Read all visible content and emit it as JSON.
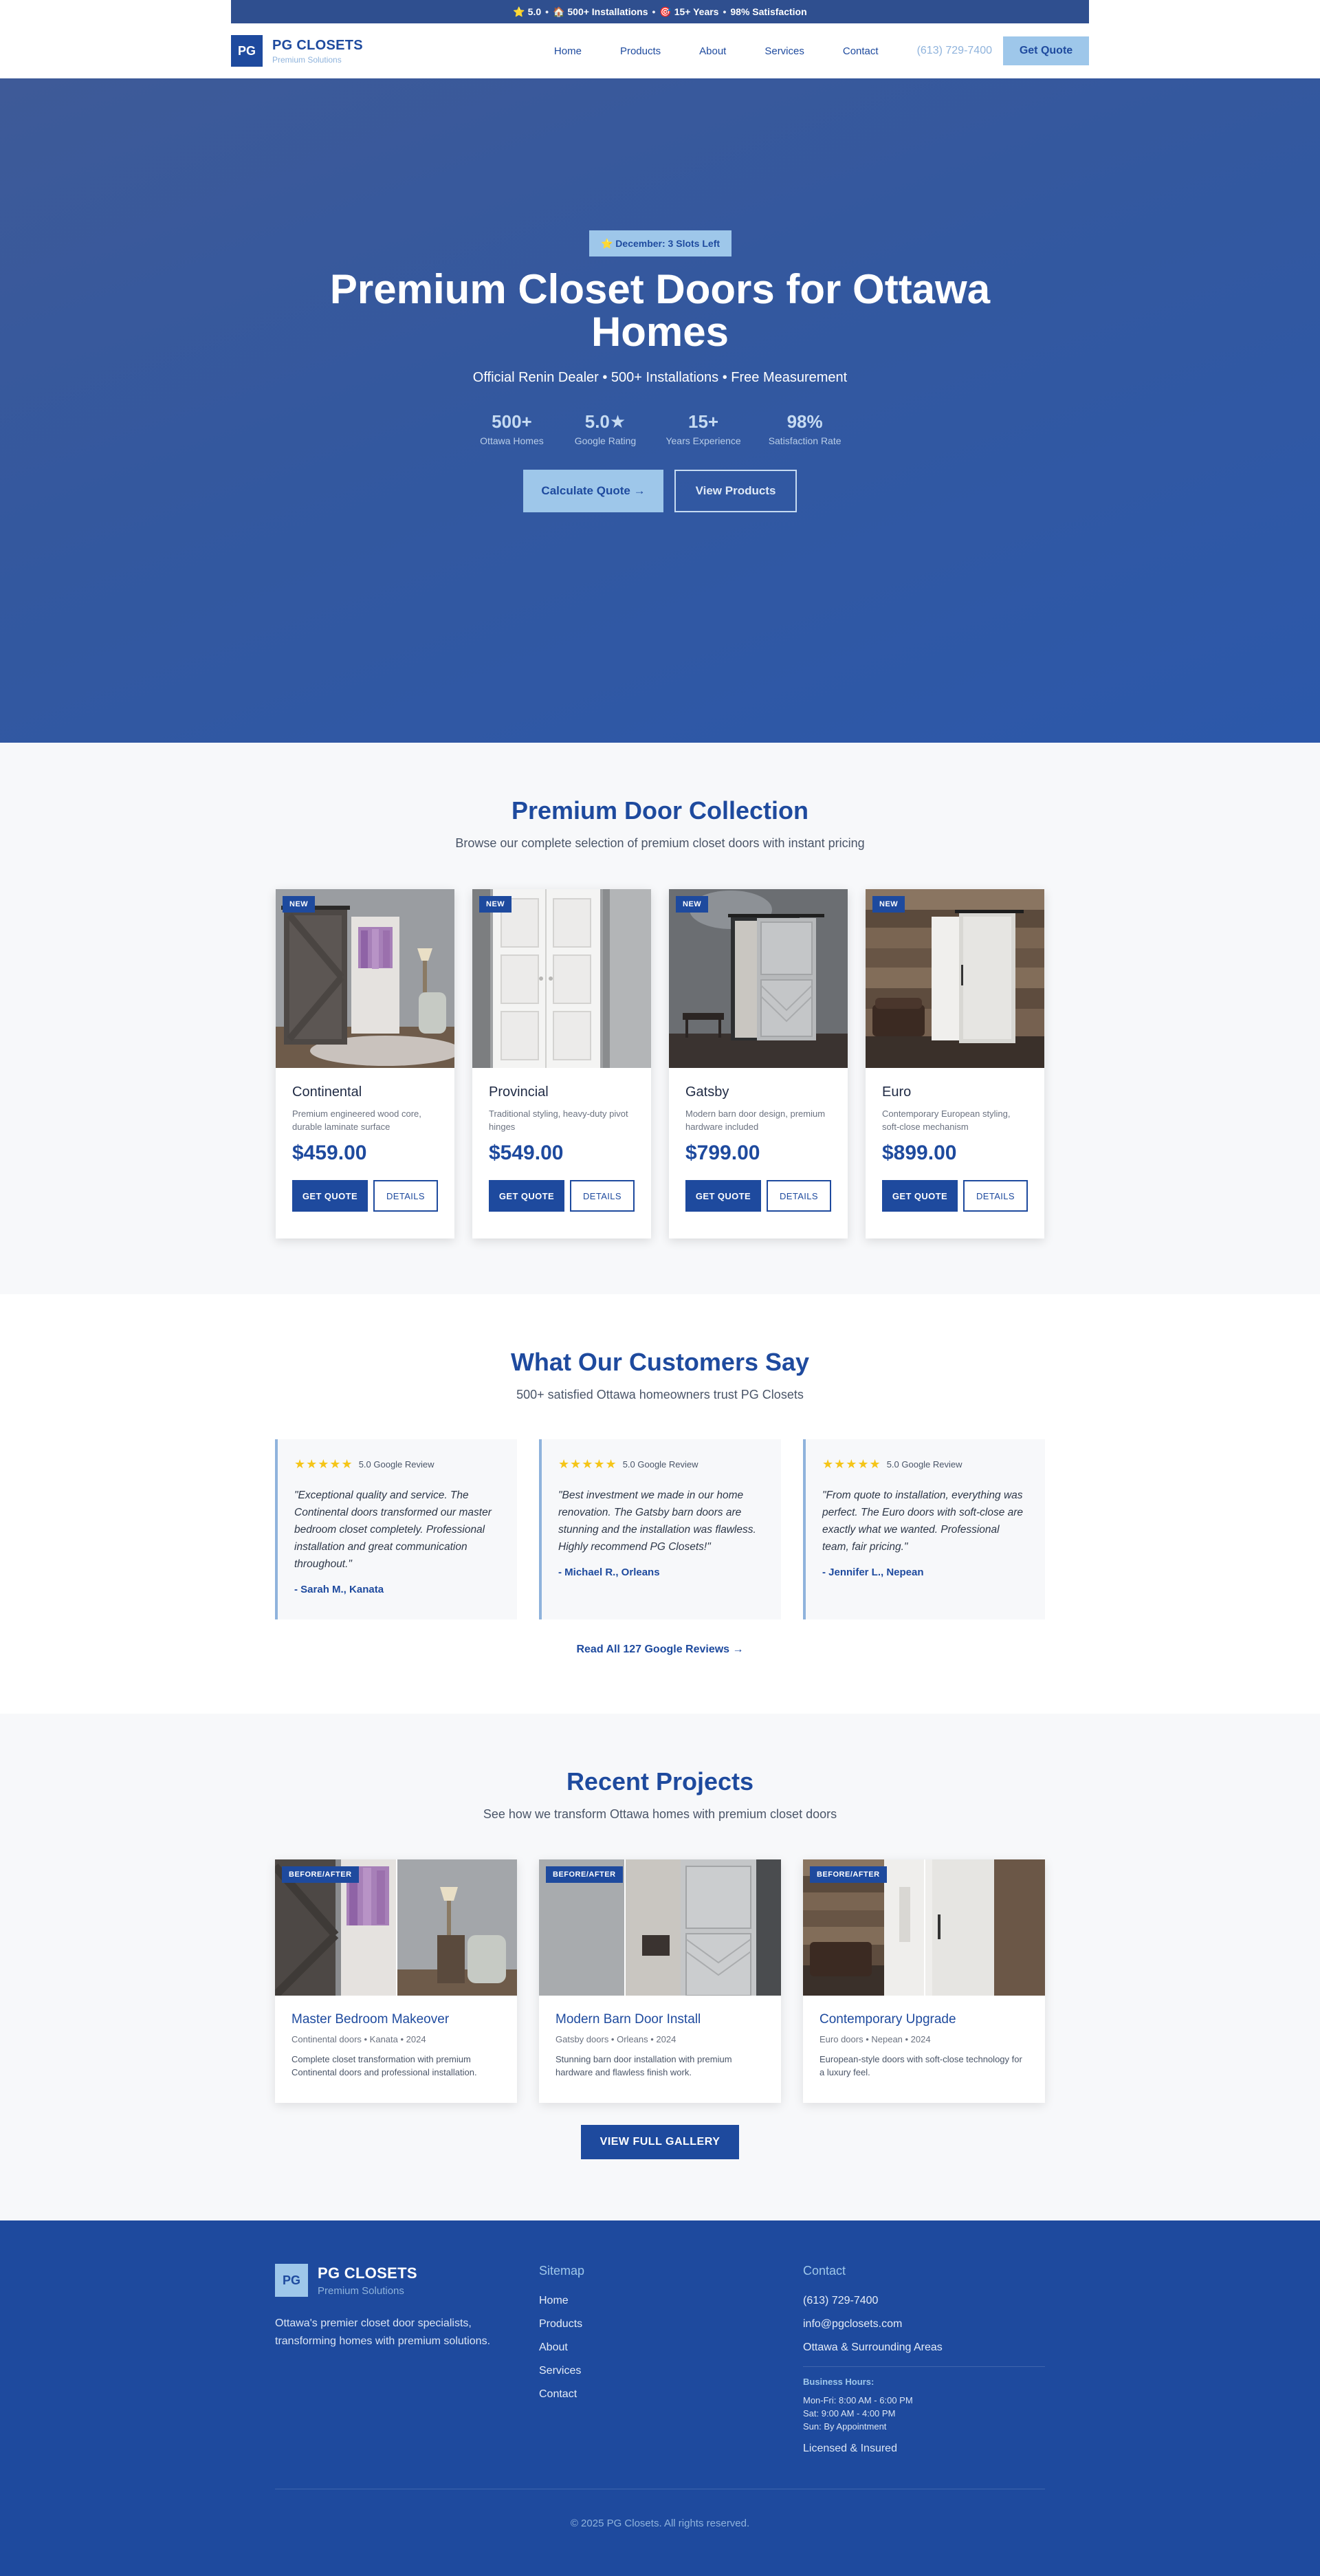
{
  "topbar": {
    "items": [
      "⭐ 5.0",
      "🏠 500+ Installations",
      "🎯 15+ Years",
      "98% Satisfaction"
    ]
  },
  "header": {
    "logo_mark": "PG",
    "logo_name": "PG CLOSETS",
    "logo_sub": "Premium Solutions",
    "nav": [
      "Home",
      "Products",
      "About",
      "Services",
      "Contact"
    ],
    "phone": "(613) 729-7400",
    "cta": "Get Quote"
  },
  "hero": {
    "badge": "⭐ December: 3 Slots Left",
    "title": "Premium Closet Doors for Ottawa Homes",
    "subtitle": "Official Renin Dealer • 500+ Installations • Free Measurement",
    "stats": [
      {
        "value": "500+",
        "label": "Ottawa Homes"
      },
      {
        "value": "5.0★",
        "label": "Google Rating"
      },
      {
        "value": "15+",
        "label": "Years Experience"
      },
      {
        "value": "98%",
        "label": "Satisfaction Rate"
      }
    ],
    "primary_btn": "Calculate Quote →",
    "secondary_btn": "View Products"
  },
  "products": {
    "title": "Premium Door Collection",
    "subtitle": "Browse our complete selection of premium closet doors with instant pricing",
    "items": [
      {
        "badge": "NEW",
        "name": "Continental",
        "desc": "Premium engineered wood core, durable laminate surface",
        "price": "$459.00",
        "quote": "GET QUOTE",
        "details": "DETAILS"
      },
      {
        "badge": "NEW",
        "name": "Provincial",
        "desc": "Traditional styling, heavy-duty pivot hinges",
        "price": "$549.00",
        "quote": "GET QUOTE",
        "details": "DETAILS"
      },
      {
        "badge": "NEW",
        "name": "Gatsby",
        "desc": "Modern barn door design, premium hardware included",
        "price": "$799.00",
        "quote": "GET QUOTE",
        "details": "DETAILS"
      },
      {
        "badge": "NEW",
        "name": "Euro",
        "desc": "Contemporary European styling, soft-close mechanism",
        "price": "$899.00",
        "quote": "GET QUOTE",
        "details": "DETAILS"
      }
    ]
  },
  "testimonials": {
    "title": "What Our Customers Say",
    "subtitle": "500+ satisfied Ottawa homeowners trust PG Closets",
    "items": [
      {
        "stars": "★★★★★",
        "rating": "5.0 Google Review",
        "quote": "\"Exceptional quality and service. The Continental doors transformed our master bedroom closet completely. Professional installation and great communication throughout.\"",
        "author": "- Sarah M., Kanata"
      },
      {
        "stars": "★★★★★",
        "rating": "5.0 Google Review",
        "quote": "\"Best investment we made in our home renovation. The Gatsby barn doors are stunning and the installation was flawless. Highly recommend PG Closets!\"",
        "author": "- Michael R., Orleans"
      },
      {
        "stars": "★★★★★",
        "rating": "5.0 Google Review",
        "quote": "\"From quote to installation, everything was perfect. The Euro doors with soft-close are exactly what we wanted. Professional team, fair pricing.\"",
        "author": "- Jennifer L., Nepean"
      }
    ],
    "link": "Read All 127 Google Reviews →"
  },
  "projects": {
    "title": "Recent Projects",
    "subtitle": "See how we transform Ottawa homes with premium closet doors",
    "items": [
      {
        "badge": "BEFORE/AFTER",
        "title": "Master Bedroom Makeover",
        "meta": "Continental doors • Kanata • 2024",
        "desc": "Complete closet transformation with premium Continental doors and professional installation."
      },
      {
        "badge": "BEFORE/AFTER",
        "title": "Modern Barn Door Install",
        "meta": "Gatsby doors • Orleans • 2024",
        "desc": "Stunning barn door installation with premium hardware and flawless finish work."
      },
      {
        "badge": "BEFORE/AFTER",
        "title": "Contemporary Upgrade",
        "meta": "Euro doors • Nepean • 2024",
        "desc": "European-style doors with soft-close technology for a luxury feel."
      }
    ],
    "gallery_btn": "VIEW FULL GALLERY"
  },
  "footer": {
    "logo_mark": "PG",
    "logo_name": "PG CLOSETS",
    "logo_sub": "Premium Solutions",
    "desc": "Ottawa's premier closet door specialists, transforming homes with premium solutions.",
    "sitemap_title": "Sitemap",
    "sitemap": [
      "Home",
      "Products",
      "About",
      "Services",
      "Contact"
    ],
    "contact_title": "Contact",
    "phone": "(613) 729-7400",
    "email": "info@pgclosets.com",
    "area": "Ottawa & Surrounding Areas",
    "hours_title": "Business Hours:",
    "hours": [
      "Mon-Fri: 8:00 AM - 6:00 PM",
      "Sat: 9:00 AM - 4:00 PM",
      "Sun: By Appointment"
    ],
    "licensed": "Licensed & Insured",
    "copyright": "© 2025 PG Closets. All rights reserved."
  }
}
